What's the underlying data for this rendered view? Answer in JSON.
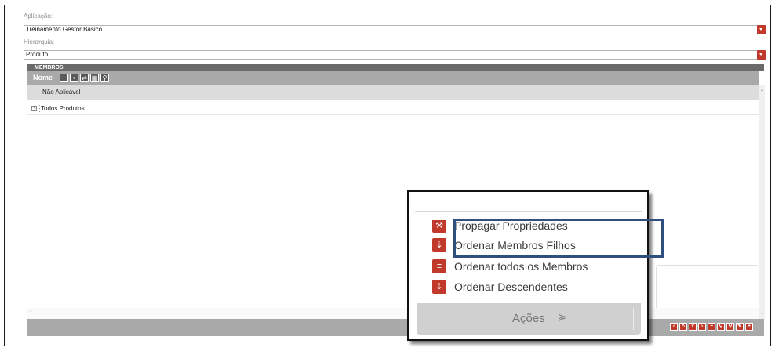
{
  "fields": {
    "aplicacao": {
      "label": "Aplicação:",
      "value": "Treinamento Gestor Básico"
    },
    "hierarquia": {
      "label": "Hierarquia:",
      "value": "Produto"
    }
  },
  "panel": {
    "title": "MEMBROS",
    "column_label": "Nome",
    "toolbar_icons": [
      "add-member-icon",
      "copy-icon",
      "move-icon",
      "grid-icon",
      "search-icon"
    ]
  },
  "tree": {
    "rows": [
      {
        "label": "Não Aplicável"
      },
      {
        "label": "Todos Produtos",
        "expander": "⊞"
      }
    ]
  },
  "popup": {
    "items": [
      {
        "label": "Propagar Propriedades",
        "icon": "wrench-icon"
      },
      {
        "label": "Ordenar Membros Filhos",
        "icon": "sort-children-icon"
      },
      {
        "label": "Ordenar todos os Membros",
        "icon": "sort-all-icon"
      },
      {
        "label": "Ordenar Descendentes",
        "icon": "sort-descendants-icon"
      }
    ],
    "actions_label": "Ações",
    "actions_chevron": "≽"
  },
  "nav_buttons": [
    "‹",
    "˄",
    "˅",
    "›",
    "−",
    "⚲",
    "⚲",
    "✎",
    "+"
  ],
  "colors": {
    "accent": "#c0392b",
    "header": "#6b6b6b",
    "toolbar": "#a9a9a9",
    "highlight": "#2f4f7e"
  }
}
